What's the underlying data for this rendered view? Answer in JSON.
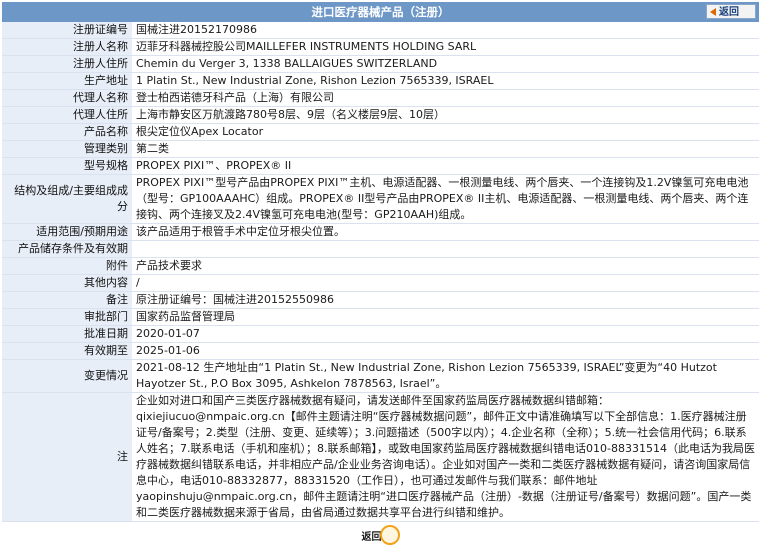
{
  "header": {
    "title": "进口医疗器械产品（注册）",
    "back_label": "返回"
  },
  "rows": [
    {
      "label": "注册证编号",
      "value": "国械注进20152170986"
    },
    {
      "label": "注册人名称",
      "value": "迈菲牙科器械控股公司MAILLEFER INSTRUMENTS HOLDING SARL"
    },
    {
      "label": "注册人住所",
      "value": "Chemin du Verger 3, 1338 BALLAIGUES SWITZERLAND"
    },
    {
      "label": "生产地址",
      "value": "1 Platin St., New Industrial Zone, Rishon Lezion 7565339, ISRAEL"
    },
    {
      "label": "代理人名称",
      "value": "登士柏西诺德牙科产品（上海）有限公司"
    },
    {
      "label": "代理人住所",
      "value": "上海市静安区万航渡路780号8层、9层（名义楼层9层、10层）"
    },
    {
      "label": "产品名称",
      "value": "根尖定位仪Apex Locator"
    },
    {
      "label": "管理类别",
      "value": "第二类"
    },
    {
      "label": "型号规格",
      "value": "PROPEX PIXI™、PROPEX® II"
    },
    {
      "label": "结构及组成/主要组成成分",
      "value": "PROPEX PIXI™型号产品由PROPEX PIXI™主机、电源适配器、一根测量电线、两个唇夹、一个连接钩及1.2V镍氢可充电电池（型号：GP100AAAHC）组成。PROPEX® II型号产品由PROPEX® II主机、电源适配器、一根测量电线、两个唇夹、两个连接钩、两个连接叉及2.4V镍氢可充电电池(型号：GP210AAH)组成。"
    },
    {
      "label": "适用范围/预期用途",
      "value": "该产品适用于根管手术中定位牙根尖位置。"
    },
    {
      "label": "产品储存条件及有效期",
      "value": ""
    },
    {
      "label": "附件",
      "value": "产品技术要求"
    },
    {
      "label": "其他内容",
      "value": "/"
    },
    {
      "label": "备注",
      "value": "原注册证编号：国械注进20152550986"
    },
    {
      "label": "审批部门",
      "value": "国家药品监督管理局"
    },
    {
      "label": "批准日期",
      "value": "2020-01-07"
    },
    {
      "label": "有效期至",
      "value": "2025-01-06"
    },
    {
      "label": "变更情况",
      "value": "2021-08-12 生产地址由“1 Platin St., New Industrial Zone, Rishon Lezion 7565339, ISRAEL”变更为“40 Hutzot Hayotzer St., P.O Box 3095, Ashkelon 7878563, Israel”。"
    },
    {
      "label": "注",
      "value": "企业如对进口和国产三类医疗器械数据有疑问，请发送邮件至国家药监局医疗器械数据纠错邮箱：qixiejiucuo@nmpaic.org.cn【邮件主题请注明“医疗器械数据问题”，邮件正文中请准确填写以下全部信息：1.医疗器械注册证号/备案号；2.类型（注册、变更、延续等）；3.问题描述（500字以内）；4.企业名称（全称）；5.统一社会信用代码；6.联系人姓名；7.联系电话（手机和座机）；8.联系邮箱】，或致电国家药监局医疗器械数据纠错电话010-88331514（此电话为我局医疗器械数据纠错联系电话，并非相应产品/企业业务咨询电话）。企业如对国产一类和二类医疗器械数据有疑问，请咨询国家局信息中心，电话010-88332877，88331520（工作日），也可通过发邮件与我们联系：邮件地址yaopinshuju@nmpaic.org.cn，邮件主题请注明“进口医疗器械产品（注册）-数据（注册证号/备案号）数据问题”。国产一类和二类医疗器械数据来源于省局，由省局通过数据共享平台进行纠错和维护。"
    }
  ],
  "footer": {
    "back_label": "返回"
  }
}
